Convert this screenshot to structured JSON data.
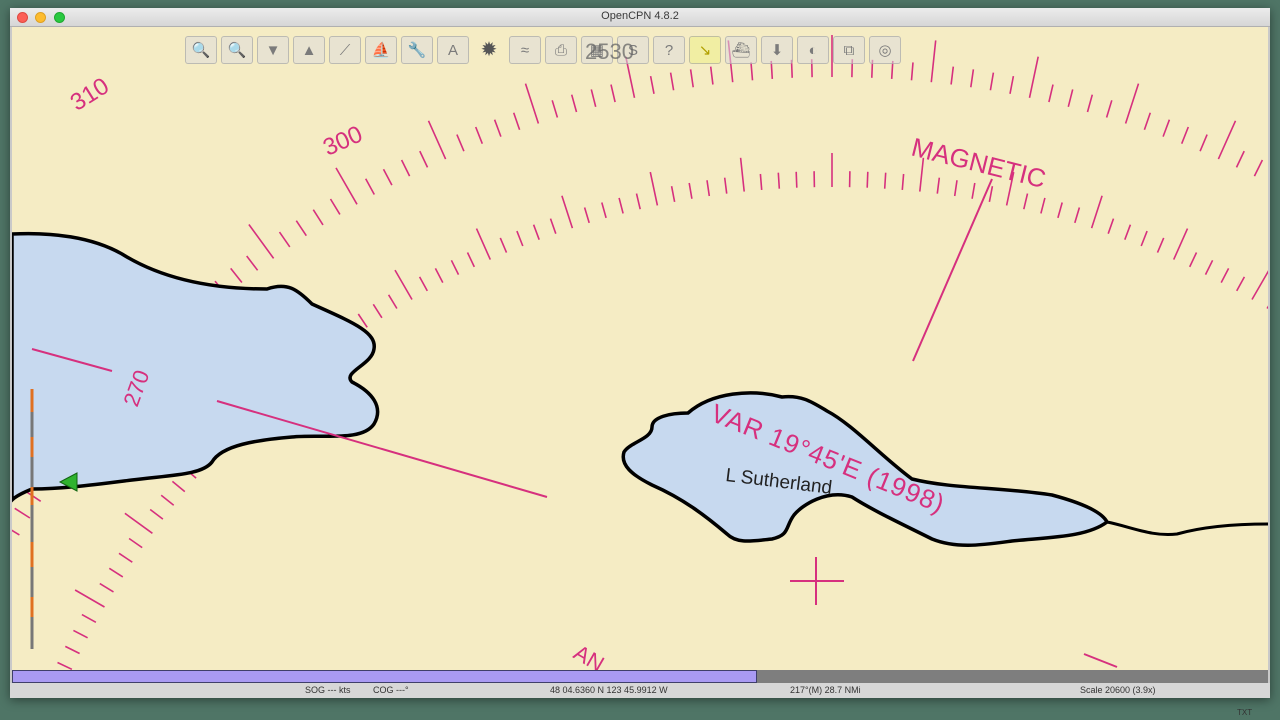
{
  "window": {
    "title": "OpenCPN 4.8.2"
  },
  "toolbar": {
    "buttons": [
      {
        "name": "zoom-in",
        "icon": "🔍"
      },
      {
        "name": "zoom-out",
        "icon": "🔍"
      },
      {
        "name": "scale-in",
        "icon": "▼"
      },
      {
        "name": "scale-out",
        "icon": "▲"
      },
      {
        "name": "route",
        "icon": "⟋"
      },
      {
        "name": "auto-follow",
        "icon": "⛵"
      },
      {
        "name": "settings",
        "icon": "🔧"
      },
      {
        "name": "text",
        "icon": "A"
      },
      {
        "name": "current",
        "icon": "✹"
      },
      {
        "name": "tide",
        "icon": "≈"
      },
      {
        "name": "print",
        "icon": "⎙"
      },
      {
        "name": "route-manager",
        "icon": "▦"
      },
      {
        "name": "track",
        "icon": "S"
      },
      {
        "name": "help",
        "icon": "?"
      },
      {
        "name": "measure",
        "icon": "↘"
      },
      {
        "name": "ais",
        "icon": "⛴"
      },
      {
        "name": "download",
        "icon": "⬇"
      },
      {
        "name": "dashboard",
        "icon": "◐"
      },
      {
        "name": "chart-downloader",
        "icon": "⧉"
      },
      {
        "name": "grib",
        "icon": "◎"
      }
    ],
    "chart_scale_overlay": "2530"
  },
  "chart": {
    "compass_labels": [
      "310",
      "300",
      "270"
    ],
    "magnetic_label": "MAGNETIC",
    "variation_label": "VAR 19°45'E (1998)",
    "lake_name": "L Sutherland",
    "partial_label": "AN",
    "colors": {
      "land": "#f5ecc4",
      "water": "#c7d9ef",
      "compass": "#d6307e",
      "coast": "#000000"
    }
  },
  "progress": {
    "fill_fraction": 0.593
  },
  "status": {
    "sog": "SOG --- kts",
    "cog": "COG ---°",
    "position": "48 04.6360 N   123 45.9912 W",
    "bearing": "217°(M)  28.7 NMi",
    "scale": "Scale 20600 (3.9x)"
  },
  "corner_label": "TXT"
}
